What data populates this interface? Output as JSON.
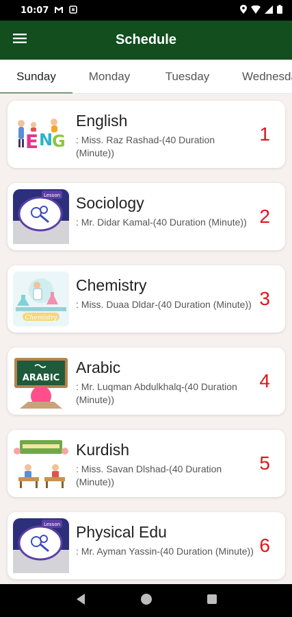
{
  "status": {
    "time": "10:07"
  },
  "app_bar": {
    "title": "Schedule"
  },
  "tabs": [
    {
      "label": "Sunday"
    },
    {
      "label": "Monday"
    },
    {
      "label": "Tuesday"
    },
    {
      "label": "Wednesday"
    }
  ],
  "lessons": [
    {
      "subject": "English",
      "teacher": ": Miss. Raz Rashad-(40 Duration (Minute))",
      "period": "1",
      "icon": "eng-letters-icon"
    },
    {
      "subject": "Sociology",
      "teacher": ": Mr. Didar Kamal-(40 Duration (Minute))",
      "period": "2",
      "icon": "lesson-badge-icon"
    },
    {
      "subject": "Chemistry",
      "teacher": ": Miss. Duaa Dldar-(40 Duration (Minute))",
      "period": "3",
      "icon": "chemistry-lab-icon"
    },
    {
      "subject": "Arabic",
      "teacher": ": Mr. Luqman Abdulkhalq-(40 Duration (Minute))",
      "period": "4",
      "icon": "arabic-board-icon"
    },
    {
      "subject": "Kurdish",
      "teacher": ": Miss. Savan Dlshad-(40 Duration (Minute))",
      "period": "5",
      "icon": "classroom-icon"
    },
    {
      "subject": "Physical Edu",
      "teacher": ": Mr. Ayman Yassin-(40 Duration (Minute))",
      "period": "6",
      "icon": "lesson-badge-icon"
    }
  ],
  "arabic_board_text": "ARABIC",
  "lesson_badge_text": "Lesson",
  "colors": {
    "app_bar": "#124e1e",
    "period": "#e0141a",
    "background": "#f6f0ee"
  }
}
